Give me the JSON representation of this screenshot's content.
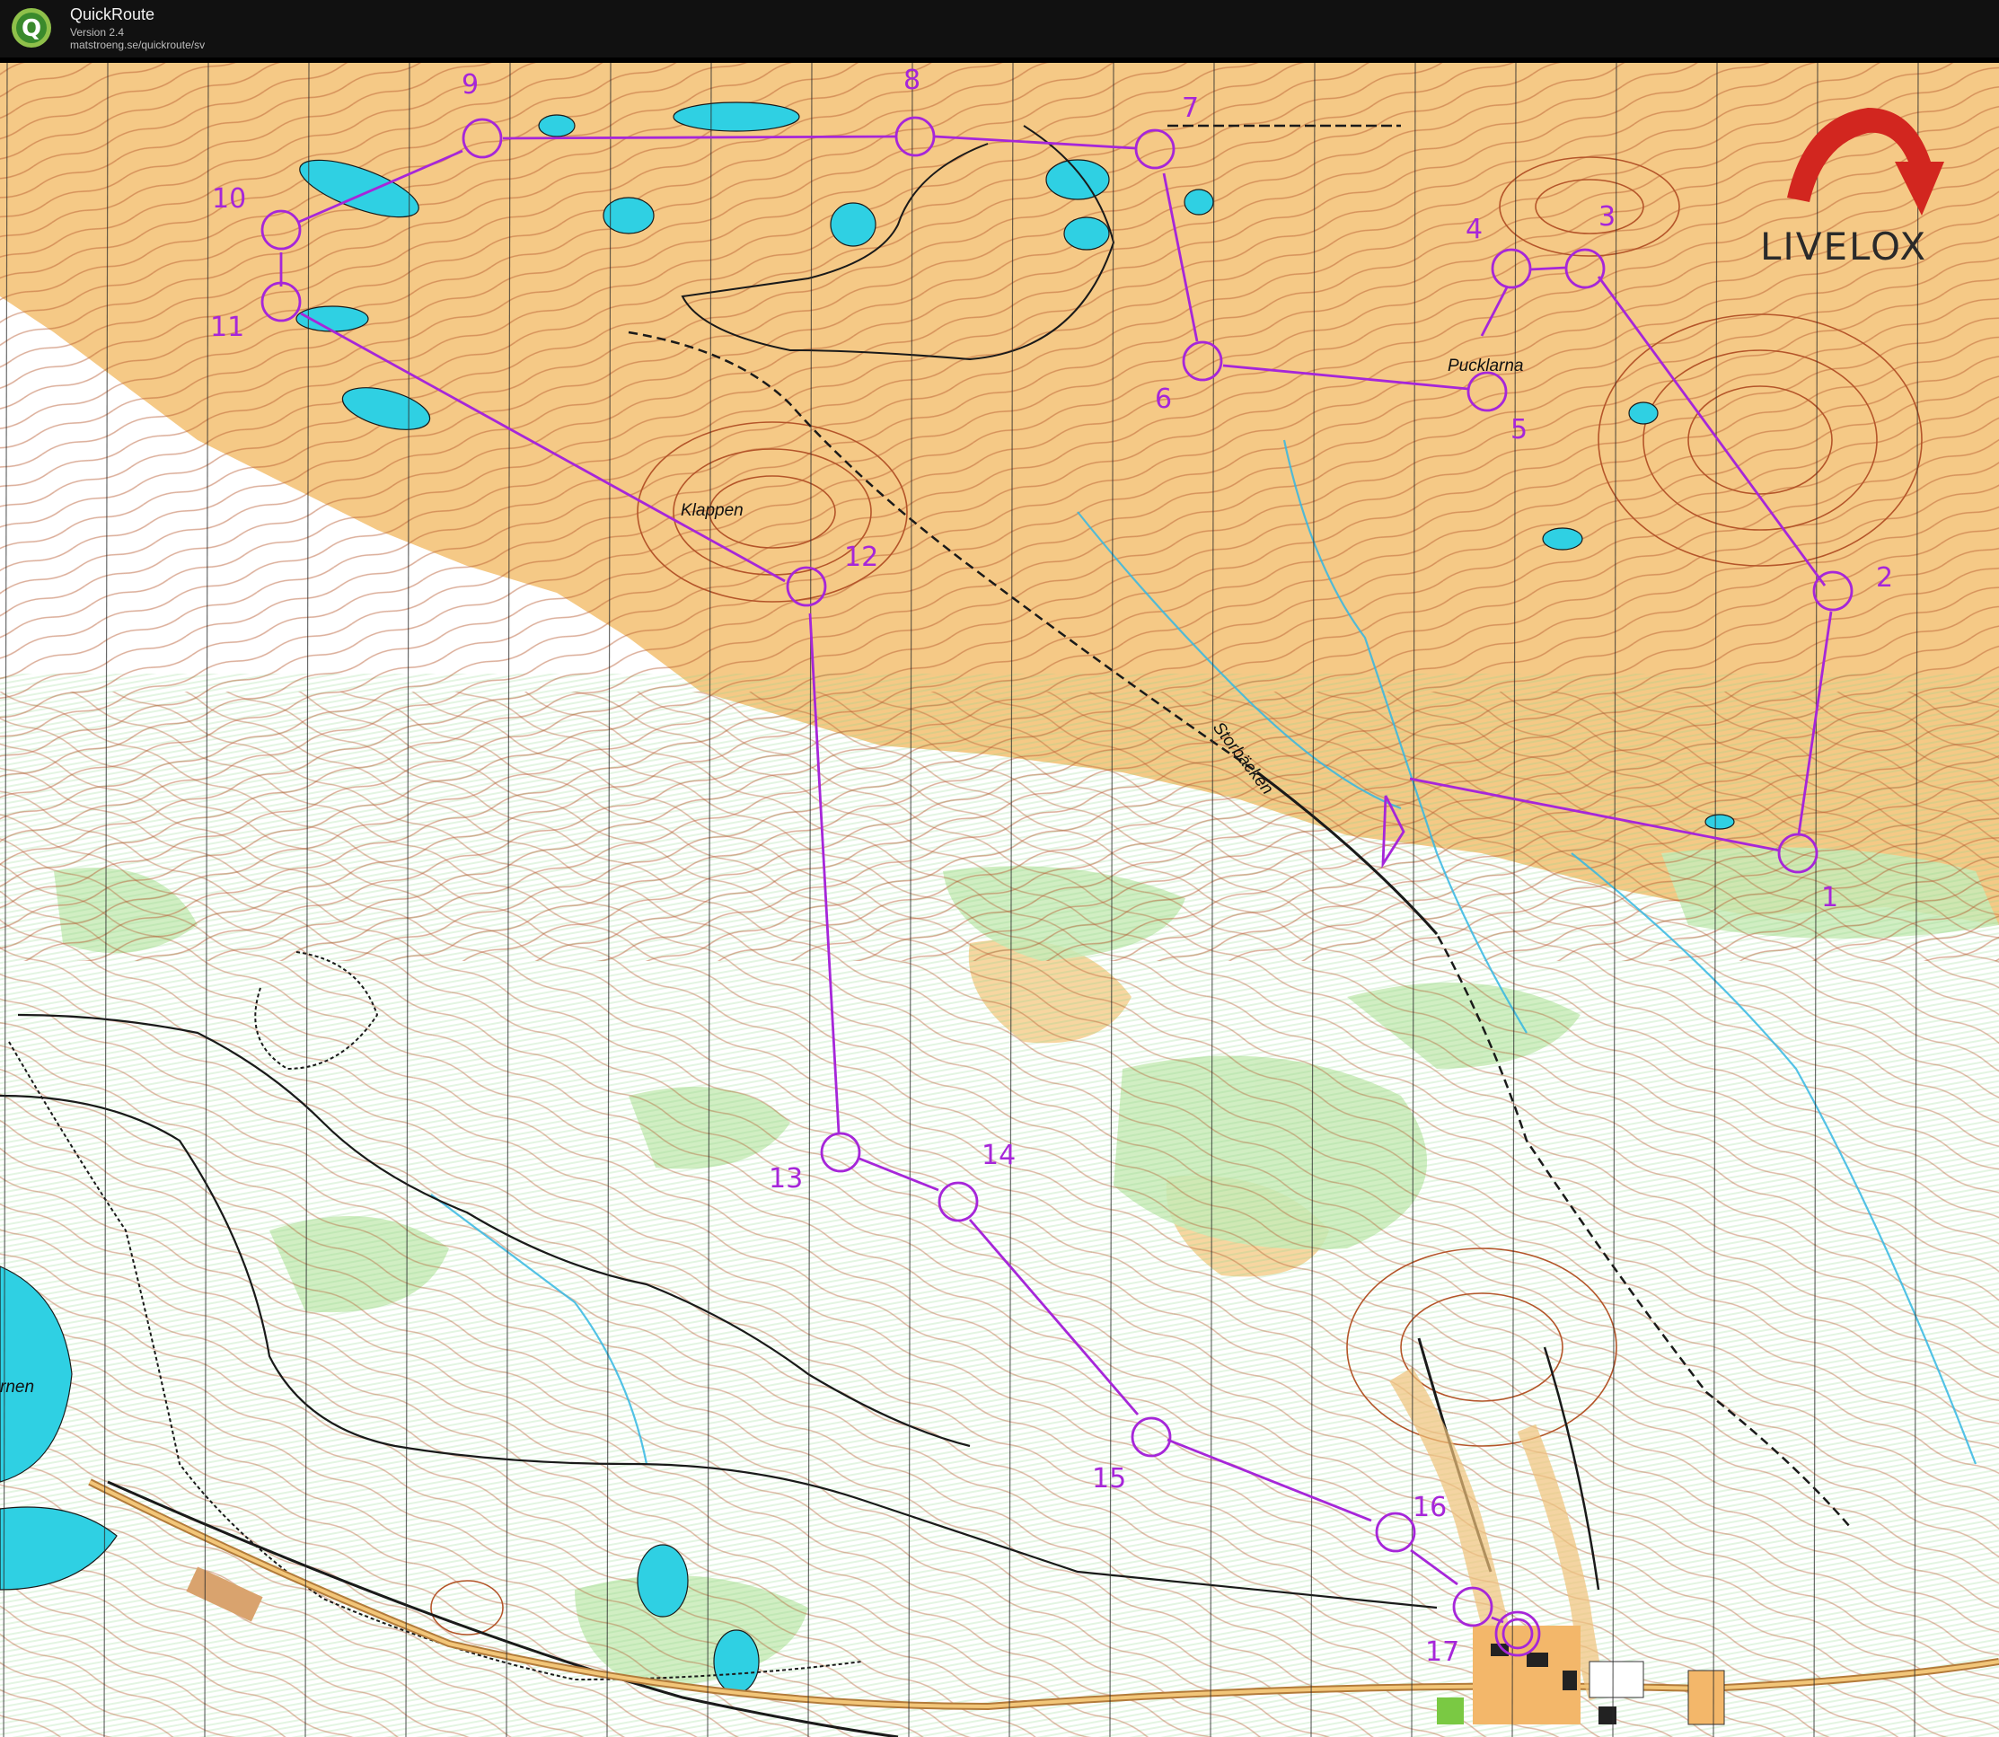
{
  "app": {
    "name": "QuickRoute",
    "version": "Version 2.4",
    "url": "matstroeng.se/quickroute/sv",
    "logo_letter": "Q"
  },
  "watermark": {
    "text": "LIVELOX",
    "arrow_color": "#d2261f"
  },
  "course": {
    "color": "#a626d9",
    "controls": [
      {
        "label": "1"
      },
      {
        "label": "2"
      },
      {
        "label": "3"
      },
      {
        "label": "4"
      },
      {
        "label": "5"
      },
      {
        "label": "6"
      },
      {
        "label": "7"
      },
      {
        "label": "8"
      },
      {
        "label": "9"
      },
      {
        "label": "10"
      },
      {
        "label": "11"
      },
      {
        "label": "12"
      },
      {
        "label": "13"
      },
      {
        "label": "14"
      },
      {
        "label": "15"
      },
      {
        "label": "16"
      },
      {
        "label": "17"
      }
    ]
  },
  "place_names": {
    "klappen": "Klappen",
    "pucklarna": "Pucklarna",
    "storbacken": "Storbäcken",
    "lake": "rnen"
  },
  "map_colors": {
    "open_land": "#f5c986",
    "contour": "#b4552a",
    "water": "#2fd0e3",
    "forest_green": "#c9ebb8",
    "magenta": "#a626d9"
  }
}
